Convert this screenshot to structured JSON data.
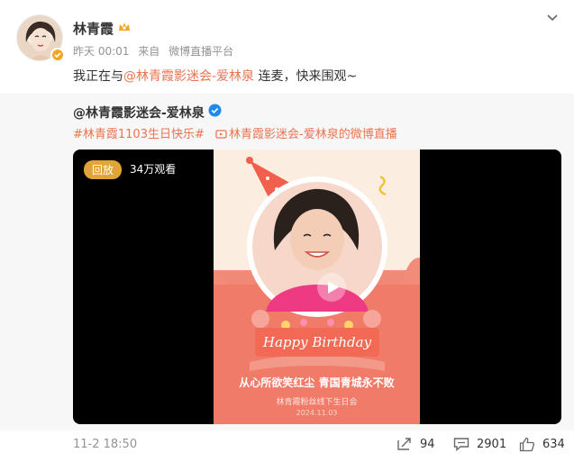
{
  "post": {
    "author": "林青霞",
    "time": "昨天 00:01",
    "source_prefix": "来自",
    "source": "微博直播平台",
    "text_prefix": "我正在与",
    "mention": "@林青霞影迷会-爱林泉",
    "text_suffix": " 连麦，快来围观~"
  },
  "repost": {
    "author": "@林青霞影迷会-爱林泉",
    "hashtag": "#林青霞1103生日快乐#",
    "live_link": "林青霞影迷会-爱林泉的微博直播",
    "video": {
      "badge": "回放",
      "views": "34万观看",
      "poster_title": "Happy Birthday",
      "poster_slogan": "从心所欲笑红尘  青国青城永不败",
      "poster_sub": "林青霞粉丝线下生日会",
      "poster_date": "2024.11.03"
    }
  },
  "footer": {
    "timestamp": "11-2 18:50",
    "reposts": "94",
    "comments": "2901",
    "likes": "634"
  },
  "colors": {
    "link": "#eb7350",
    "badge": "#e1a438",
    "muted": "#939393"
  },
  "icons": [
    "avatar",
    "vip-crown-icon",
    "verified-icon",
    "chevron-down-icon",
    "live-icon",
    "play-icon",
    "repost-icon",
    "comment-icon",
    "like-icon"
  ]
}
